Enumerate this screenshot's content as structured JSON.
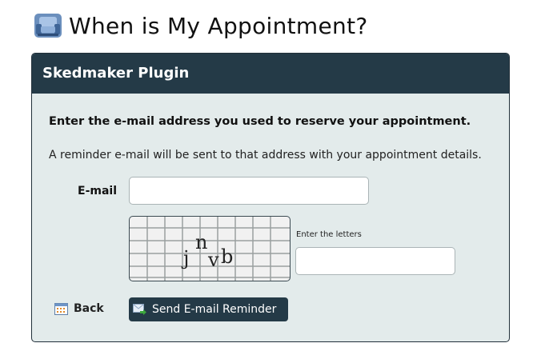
{
  "page": {
    "title": "When is My Appointment?",
    "title_icon": "sofa-icon"
  },
  "panel": {
    "header": "Skedmaker Plugin",
    "instructions": "Enter the e-mail address you used to reserve your appointment.",
    "reminder_text": "A reminder e-mail will be sent to that address with your appointment details."
  },
  "form": {
    "email_label": "E-mail",
    "email_value": "",
    "captcha_text": "jnvb",
    "captcha_label": "Enter the letters",
    "captcha_value": ""
  },
  "actions": {
    "back_label": "Back",
    "back_icon": "calendar-icon",
    "send_label": "Send E-mail Reminder",
    "send_icon": "send-mail-icon"
  },
  "colors": {
    "header_bg": "#243a47",
    "panel_bg": "#e3ebeb",
    "button_bg": "#243a47"
  }
}
